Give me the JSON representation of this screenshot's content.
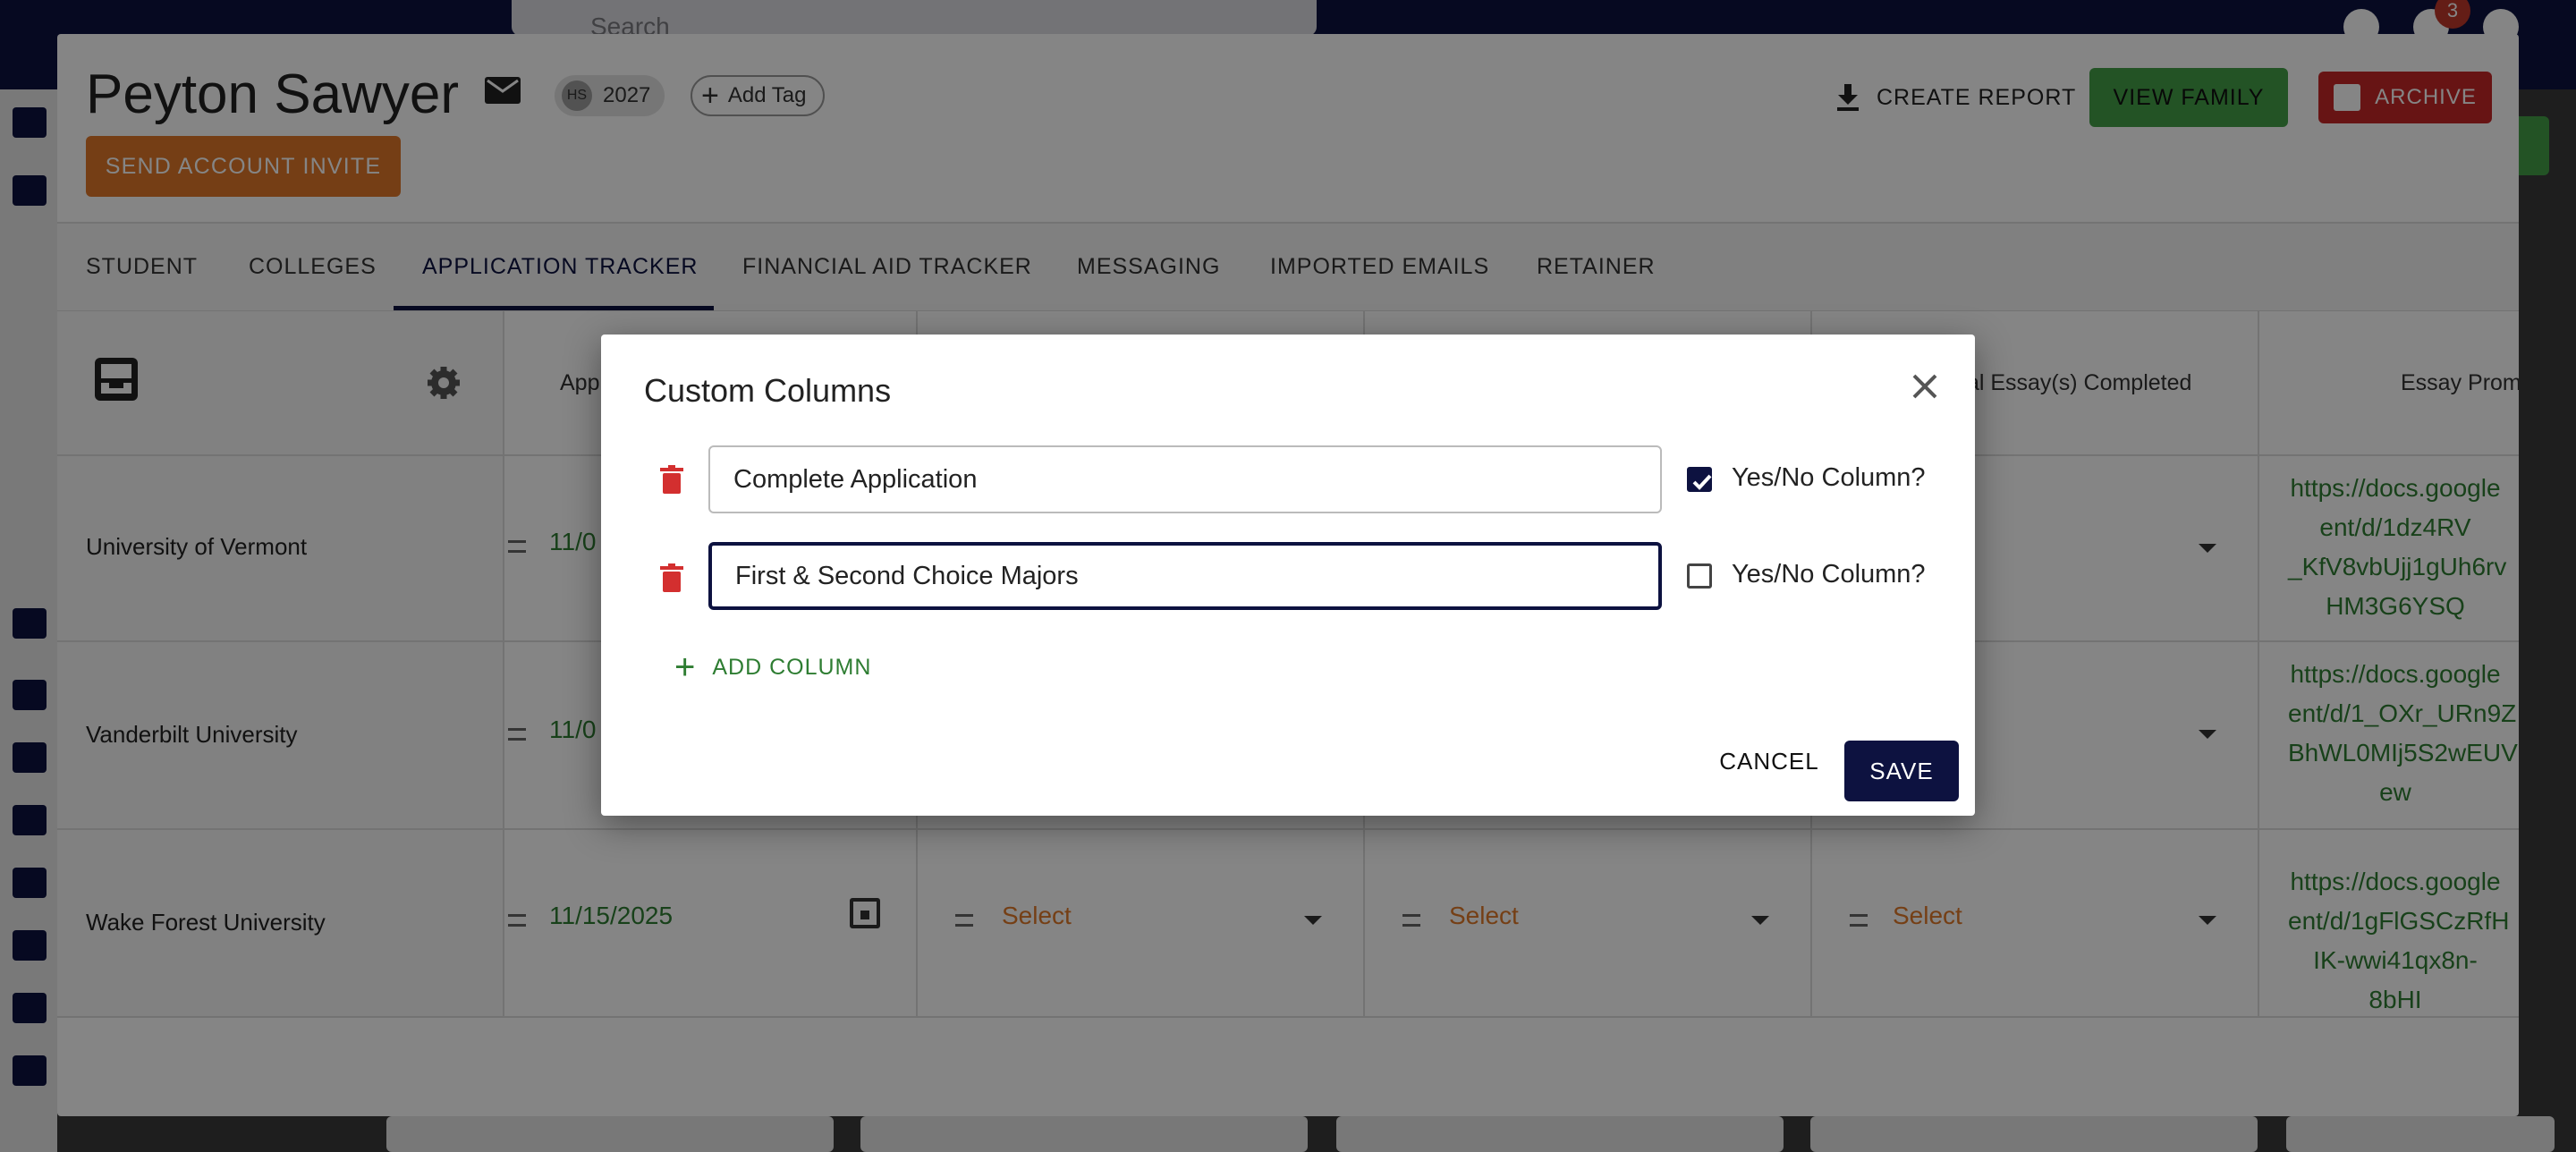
{
  "topbar": {
    "search_placeholder": "Search",
    "notification_count": "3"
  },
  "header": {
    "student_name": "Peyton Sawyer",
    "class_badge_initials": "HS",
    "class_year": "2027",
    "add_tag_label": "Add Tag",
    "send_invite_label": "SEND ACCOUNT INVITE",
    "create_report_label": "CREATE REPORT",
    "view_family_label": "VIEW FAMILY",
    "archive_label": "ARCHIVE"
  },
  "tabs": [
    {
      "label": "STUDENT"
    },
    {
      "label": "COLLEGES"
    },
    {
      "label": "APPLICATION TRACKER"
    },
    {
      "label": "FINANCIAL AID TRACKER"
    },
    {
      "label": "MESSAGING"
    },
    {
      "label": "IMPORTED EMAILS"
    },
    {
      "label": "RETAINER"
    }
  ],
  "table": {
    "headers": {
      "col1_partial": "App",
      "col4_partial": "tal Essay(s) Completed",
      "col5_partial": "Essay Prom"
    },
    "rows": [
      {
        "college": "University of Vermont",
        "date_partial": "11/0",
        "link": "https://docs.google\nent/d/1dz4RV\n_KfV8vbUjj1gUh6rv\nHM3G6YSQ"
      },
      {
        "college": "Vanderbilt University",
        "date_partial": "11/0",
        "link": "https://docs.google\nent/d/1_OXr_URn9Z\nBhWL0MIj5S2wEUV\new"
      },
      {
        "college": "Wake Forest University",
        "date": "11/15/2025",
        "select1": "Select",
        "select2": "Select",
        "select3": "Select",
        "link": "https://docs.google\nent/d/1gFlGSCzRfH\nIK-wwi41qx8n-8bHI"
      }
    ]
  },
  "modal": {
    "title": "Custom Columns",
    "columns": [
      {
        "value": "Complete Application",
        "yes_no": true,
        "yes_no_label": "Yes/No Column?"
      },
      {
        "value": "First & Second Choice Majors ",
        "yes_no": false,
        "yes_no_label": "Yes/No Column?"
      }
    ],
    "add_column_label": "ADD COLUMN",
    "cancel_label": "CANCEL",
    "save_label": "SAVE"
  }
}
